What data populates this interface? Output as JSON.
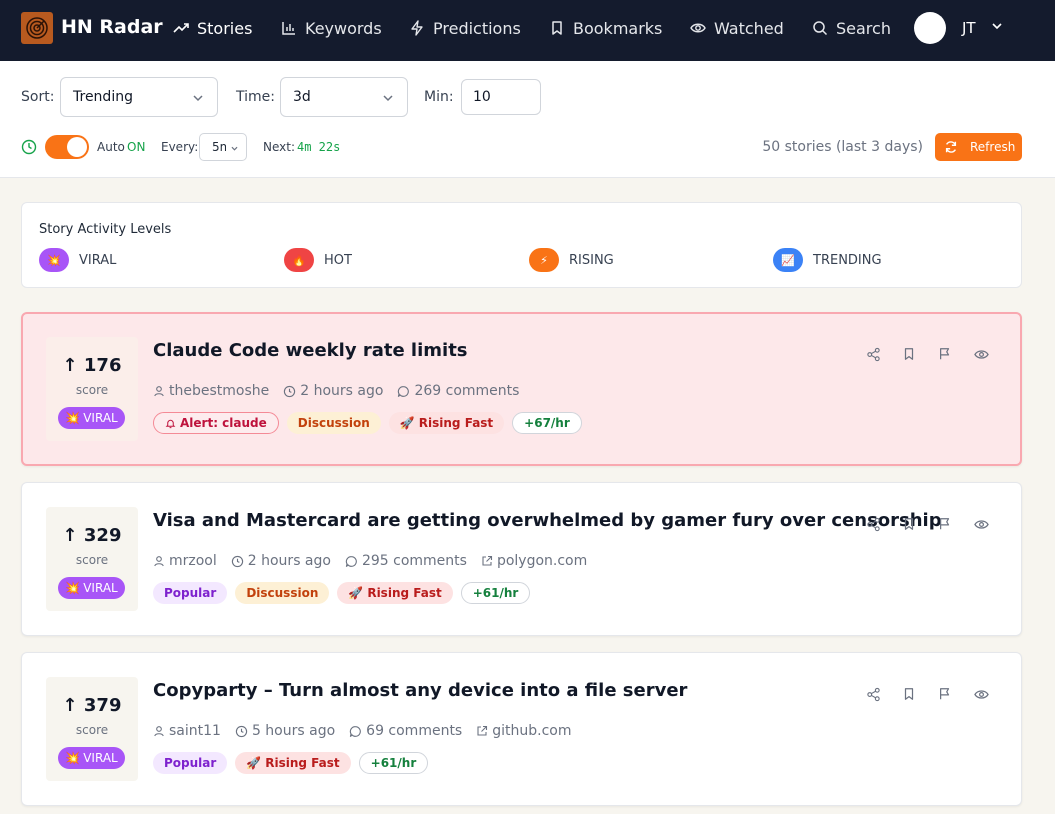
{
  "nav": {
    "brand": "HN Radar",
    "items": [
      {
        "label": "Stories",
        "icon": "trending-up-icon"
      },
      {
        "label": "Keywords",
        "icon": "bar-chart-icon"
      },
      {
        "label": "Predictions",
        "icon": "lightning-icon"
      },
      {
        "label": "Bookmarks",
        "icon": "bookmark-icon"
      },
      {
        "label": "Watched",
        "icon": "eye-icon"
      },
      {
        "label": "Search",
        "icon": "search-icon"
      }
    ],
    "user_initials": "JT"
  },
  "filters": {
    "sort_label": "Sort:",
    "sort_value": "Trending",
    "time_label": "Time:",
    "time_value": "3d",
    "min_label": "Min:",
    "min_value": "10",
    "auto_label": "Auto",
    "auto_state": "ON",
    "every_label": "Every:",
    "every_value": "5m",
    "next_label": "Next:",
    "next_value": "4m 22s",
    "count_text": "50 stories (last 3 days)",
    "refresh_label": "Refresh"
  },
  "legend": {
    "title": "Story Activity Levels",
    "items": [
      {
        "label": "VIRAL",
        "icon": "💥",
        "color": "#a855f7"
      },
      {
        "label": "HOT",
        "icon": "🔥",
        "color": "#ef4444"
      },
      {
        "label": "RISING",
        "icon": "⚡",
        "color": "#f97316"
      },
      {
        "label": "TRENDING",
        "icon": "📈",
        "color": "#3b82f6"
      }
    ]
  },
  "stories": [
    {
      "score": "176",
      "score_label": "score",
      "level": "VIRAL",
      "level_icon": "💥",
      "title": "Claude Code weekly rate limits",
      "author": "thebestmoshe",
      "time": "2 hours ago",
      "comments": "269 comments",
      "domain": "",
      "tags": [
        {
          "label": "Alert: claude",
          "kind": "alert",
          "icon": "bell-icon"
        },
        {
          "label": "Discussion",
          "kind": "discussion"
        },
        {
          "label": "Rising Fast",
          "kind": "rising",
          "prefix": "🚀"
        },
        {
          "label": "+67/hr",
          "kind": "rate"
        }
      ]
    },
    {
      "score": "329",
      "score_label": "score",
      "level": "VIRAL",
      "level_icon": "💥",
      "title": "Visa and Mastercard are getting overwhelmed by gamer fury over censorship",
      "author": "mrzool",
      "time": "2 hours ago",
      "comments": "295 comments",
      "domain": "polygon.com",
      "tags": [
        {
          "label": "Popular",
          "kind": "popular"
        },
        {
          "label": "Discussion",
          "kind": "discussion"
        },
        {
          "label": "Rising Fast",
          "kind": "rising",
          "prefix": "🚀"
        },
        {
          "label": "+61/hr",
          "kind": "rate"
        }
      ]
    },
    {
      "score": "379",
      "score_label": "score",
      "level": "VIRAL",
      "level_icon": "💥",
      "title": "Copyparty – Turn almost any device into a file server",
      "author": "saint11",
      "time": "5 hours ago",
      "comments": "69 comments",
      "domain": "github.com",
      "tags": [
        {
          "label": "Popular",
          "kind": "popular"
        },
        {
          "label": "Rising Fast",
          "kind": "rising",
          "prefix": "🚀"
        },
        {
          "label": "+61/hr",
          "kind": "rate"
        }
      ]
    }
  ]
}
